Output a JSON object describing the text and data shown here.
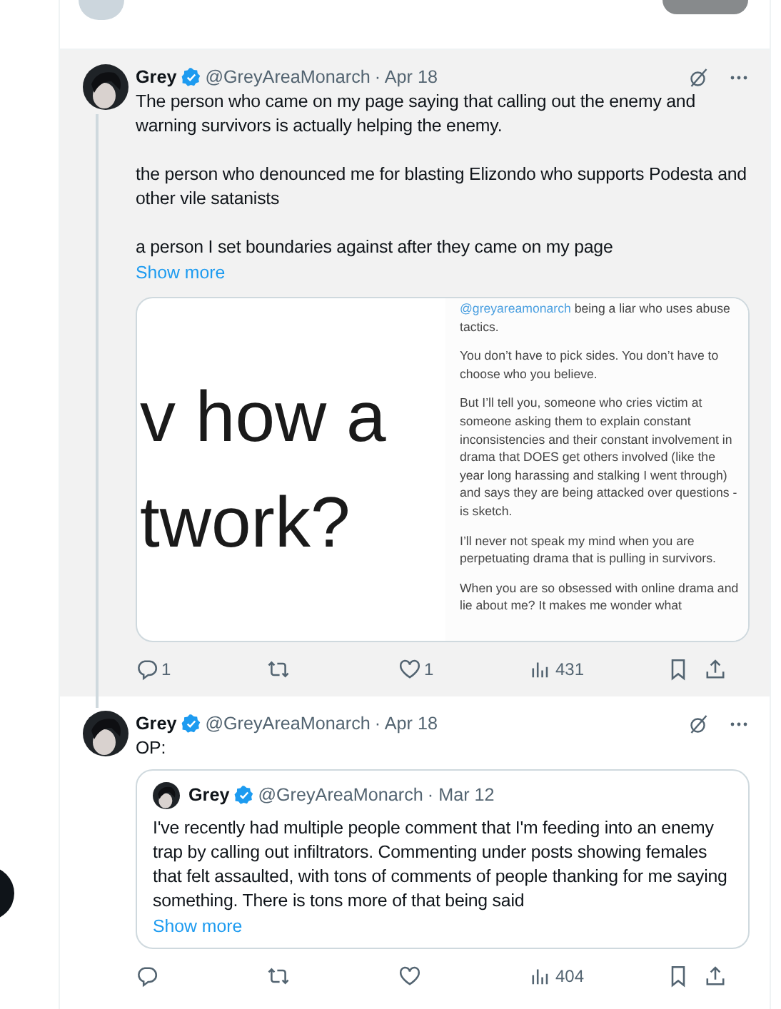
{
  "tweets": [
    {
      "name": "Grey",
      "verified": true,
      "handle": "@GreyAreaMonarch",
      "date": "· Apr 18",
      "highlighted": true,
      "thread_line": true,
      "paragraphs": [
        "The person who came on my page saying that calling out the enemy and warning survivors is actually helping the enemy.",
        "the person who denounced me for blasting Elizondo who supports Podesta and other vile satanists",
        "a person I set boundaries against after they came on my page"
      ],
      "show_more": "Show more",
      "media": {
        "big_lines": [
          "v how a",
          "twork?"
        ],
        "mention": "@greyareamonarch",
        "first_rest": " being a liar who uses abuse tactics.",
        "paragraphs": [
          "You don’t have to pick sides. You don’t have to choose who you believe.",
          "But I’ll tell you, someone who cries victim at someone asking them to explain constant inconsistencies and their constant involvement in drama that DOES get others involved (like the year long harassing and stalking I went through) and says they are being attacked over questions - is sketch.",
          "I’ll never not speak my mind when you are perpetuating drama that is pulling in survivors.",
          "When you are so obsessed with online drama and lie about me? It makes me wonder what"
        ]
      },
      "actions": [
        {
          "kind": "reply",
          "count": "1"
        },
        {
          "kind": "repost"
        },
        {
          "kind": "like",
          "count": "1"
        },
        {
          "kind": "views",
          "count": "431"
        },
        {
          "kind": "bookmark"
        },
        {
          "kind": "share"
        }
      ]
    },
    {
      "name": "Grey",
      "verified": true,
      "handle": "@GreyAreaMonarch",
      "date": "· Apr 18",
      "highlighted": false,
      "thread_line": false,
      "paragraphs": [
        "OP:"
      ],
      "quote": {
        "name": "Grey",
        "verified": true,
        "handle": "@GreyAreaMonarch",
        "date": "· Mar 12",
        "text": "I've recently had multiple people comment that I'm feeding into an enemy trap by calling out infiltrators. Commenting under posts showing females that felt assaulted, with tons of comments of people thanking for me saying something. There is tons more of that being said",
        "show_more": "Show more"
      },
      "actions": [
        {
          "kind": "reply"
        },
        {
          "kind": "repost"
        },
        {
          "kind": "like"
        },
        {
          "kind": "views",
          "count": "404"
        },
        {
          "kind": "bookmark"
        },
        {
          "kind": "share"
        }
      ]
    }
  ]
}
